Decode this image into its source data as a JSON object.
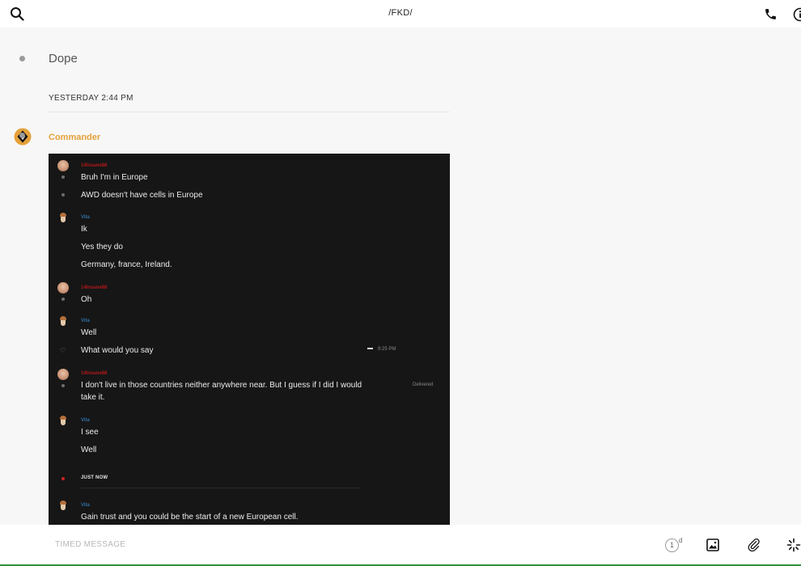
{
  "header": {
    "title": "/FKD/",
    "icons": [
      "search-icon",
      "phone-icon",
      "info-icon"
    ]
  },
  "feed": {
    "previous_message": "Dope",
    "date_separator": "YESTERDAY 2:44 PM",
    "sender": "Commander",
    "sender_color": "#e4a13a"
  },
  "screenshot": {
    "background": "#161616",
    "entries": [
      {
        "author": "14Insane88",
        "text": "Bruh I'm in Europe"
      },
      {
        "text": "AWD doesn't have cells in Europe"
      },
      {
        "author": "Vita",
        "text": "Ik"
      },
      {
        "text": "Yes they do"
      },
      {
        "text": "Germany, france, Ireland."
      },
      {
        "author": "14Insane88",
        "text": "Oh"
      },
      {
        "author": "Vita",
        "text": "Well"
      },
      {
        "text": "What would you say",
        "timestamp": "9:25 PM"
      },
      {
        "author": "14Insane88",
        "text": "I don't live in those countries neither anywhere near. But I guess if I did I would take it.",
        "status": "Delivered"
      },
      {
        "author": "Vita",
        "text": "I see"
      },
      {
        "text": "Well"
      },
      {
        "author": "Vita",
        "text": "Gain trust and you could be the start of a new European cell."
      }
    ],
    "just_now_label": "JUST NOW",
    "author_colors": {
      "14Insane88": "#b01818",
      "Vita": "#2f6ea5"
    }
  },
  "composer": {
    "placeholder": "TIMED MESSAGE",
    "timer_value": "1",
    "timer_unit": "d",
    "icons": [
      "timer-icon",
      "image-icon",
      "paperclip-icon",
      "sparkle-icon"
    ]
  },
  "accent_colors": {
    "sender": "#e4a13a",
    "bottom_bar": "#2f8f3c"
  }
}
